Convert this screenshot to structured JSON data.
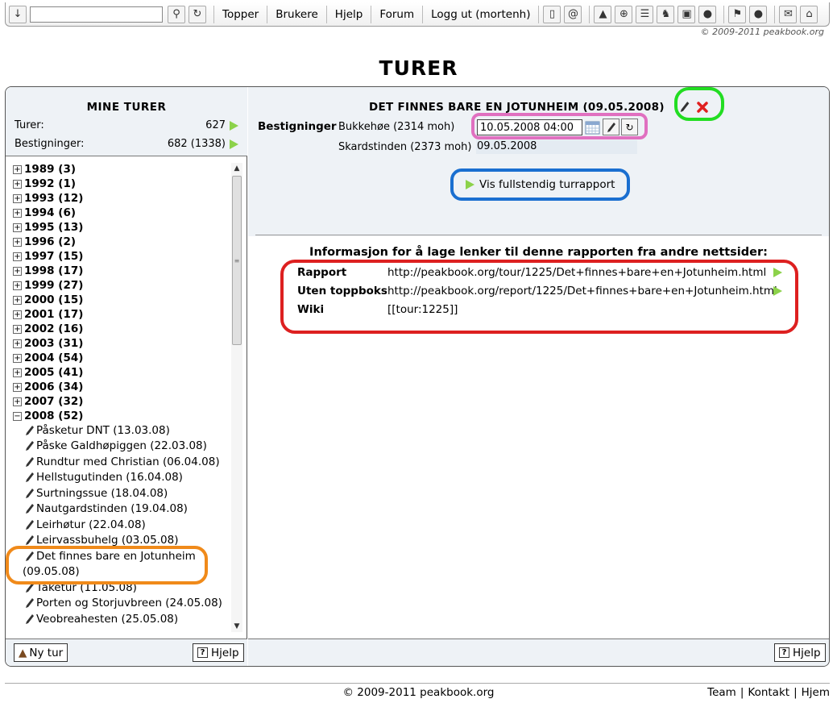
{
  "toolbar": {
    "search_value": "",
    "links": [
      "Topper",
      "Brukere",
      "Hjelp",
      "Forum",
      "Logg ut (mortenh)"
    ],
    "left_icons": [
      "download-icon",
      "search-icon",
      "refresh-icon"
    ],
    "right_icons": [
      "phone-icon",
      "at-icon",
      "mountain-icon",
      "plus-circle-icon",
      "list-icon",
      "boot-icon",
      "picture-icon",
      "speech-bubble-icon",
      "pin-icon",
      "globe-icon",
      "mail-icon",
      "home-icon"
    ],
    "copyright": "© 2009-2011 peakbook.org"
  },
  "page_title": "TURER",
  "left_panel": {
    "title": "MINE TURER",
    "turer_label": "Turer:",
    "turer_value": "627",
    "bestigninger_label": "Bestigninger:",
    "bestigninger_value": "682 (1338)",
    "years": [
      {
        "label": "1989 (3)",
        "toggle": "+"
      },
      {
        "label": "1992 (1)",
        "toggle": "+"
      },
      {
        "label": "1993 (12)",
        "toggle": "+"
      },
      {
        "label": "1994 (6)",
        "toggle": "+"
      },
      {
        "label": "1995 (13)",
        "toggle": "+"
      },
      {
        "label": "1996 (2)",
        "toggle": "+"
      },
      {
        "label": "1997 (15)",
        "toggle": "+"
      },
      {
        "label": "1998 (17)",
        "toggle": "+"
      },
      {
        "label": "1999 (27)",
        "toggle": "+"
      },
      {
        "label": "2000 (15)",
        "toggle": "+"
      },
      {
        "label": "2001 (17)",
        "toggle": "+"
      },
      {
        "label": "2002 (16)",
        "toggle": "+"
      },
      {
        "label": "2003 (31)",
        "toggle": "+"
      },
      {
        "label": "2004 (54)",
        "toggle": "+"
      },
      {
        "label": "2005 (41)",
        "toggle": "+"
      },
      {
        "label": "2006 (34)",
        "toggle": "+"
      },
      {
        "label": "2007 (32)",
        "toggle": "+"
      },
      {
        "label": "2008 (52)",
        "toggle": "−"
      }
    ],
    "tours": [
      "Påsketur DNT (13.03.08)",
      "Påske Galdhøpiggen (22.03.08)",
      "Rundtur med Christian (06.04.08)",
      "Hellstugutinden (16.04.08)",
      "Surtningssue (18.04.08)",
      "Nautgardstinden (19.04.08)",
      "Leirhøtur (22.04.08)",
      "Leirvassbuhelg (03.05.08)",
      "Det finnes bare en Jotunheim",
      "(09.05.08)",
      "Tåketur (11.05.08)",
      "Porten og Storjuvbreen (24.05.08)",
      "Veobreahesten (25.05.08)"
    ],
    "new_tour_label": "Ny tur",
    "help_label": "Hjelp"
  },
  "right_panel": {
    "tour_title": "DET FINNES BARE EN JOTUNHEIM (09.05.2008)",
    "bestigninger_label": "Bestigninger",
    "ascents": [
      {
        "peak": "Bukkehøe (2314 moh)",
        "date": "10.05.2008 04:00"
      },
      {
        "peak": "Skardstinden (2373 moh)",
        "date": "09.05.2008"
      }
    ],
    "full_report_label": "Vis fullstendig turrapport",
    "info_title": "Informasjon for å lage lenker til denne rapporten fra andre nettsider:",
    "links": [
      {
        "label": "Rapport",
        "value": "http://peakbook.org/tour/1225/Det+finnes+bare+en+Jotunheim.html"
      },
      {
        "label": "Uten toppboks",
        "value": "http://peakbook.org/report/1225/Det+finnes+bare+en+Jotunheim.html"
      },
      {
        "label": "Wiki",
        "value": "[[tour:1225]]"
      }
    ],
    "help_label": "Hjelp"
  },
  "annotation_colors": {
    "green": "#22dd22",
    "pink": "#e070c0",
    "blue": "#1a6fd0",
    "red": "#dd2020",
    "orange": "#f08a1a",
    "play_arrow": "#8cd24a"
  },
  "footer": {
    "copyright": "© 2009-2011 peakbook.org",
    "links": [
      "Team",
      "Kontakt",
      "Hjem"
    ]
  }
}
